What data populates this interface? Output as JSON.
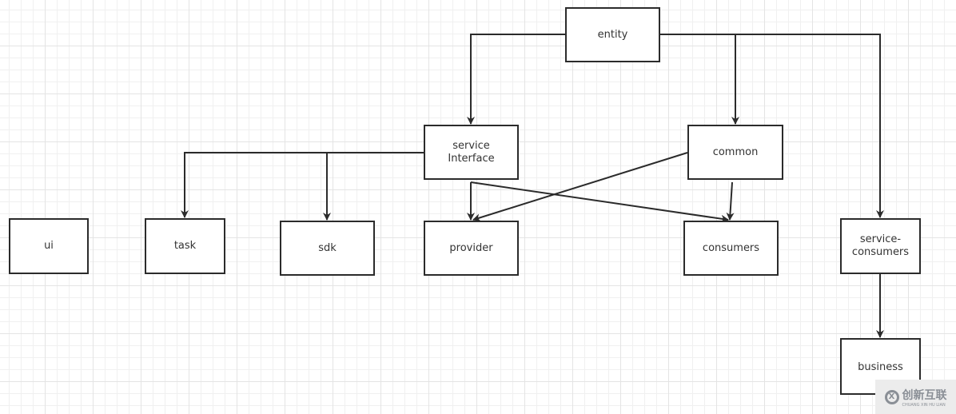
{
  "nodes": {
    "entity": "entity",
    "service_interface": "service\nInterface",
    "common": "common",
    "ui": "ui",
    "task": "task",
    "sdk": "sdk",
    "provider": "provider",
    "consumers": "consumers",
    "service_consumers": "service-\nconsumers",
    "business": "business"
  },
  "edges": [
    {
      "from": "entity",
      "to": "service_interface"
    },
    {
      "from": "entity",
      "to": "common"
    },
    {
      "from": "entity",
      "to": "service_consumers"
    },
    {
      "from": "service_interface",
      "to": "task"
    },
    {
      "from": "service_interface",
      "to": "sdk"
    },
    {
      "from": "service_interface",
      "to": "provider"
    },
    {
      "from": "service_interface",
      "to": "consumers"
    },
    {
      "from": "common",
      "to": "provider"
    },
    {
      "from": "common",
      "to": "consumers"
    },
    {
      "from": "service_consumers",
      "to": "business"
    }
  ],
  "watermark": {
    "text": "创新互联",
    "subtext": "CHUANG XIN HU LIAN"
  },
  "colors": {
    "stroke": "#2b2b2b"
  }
}
